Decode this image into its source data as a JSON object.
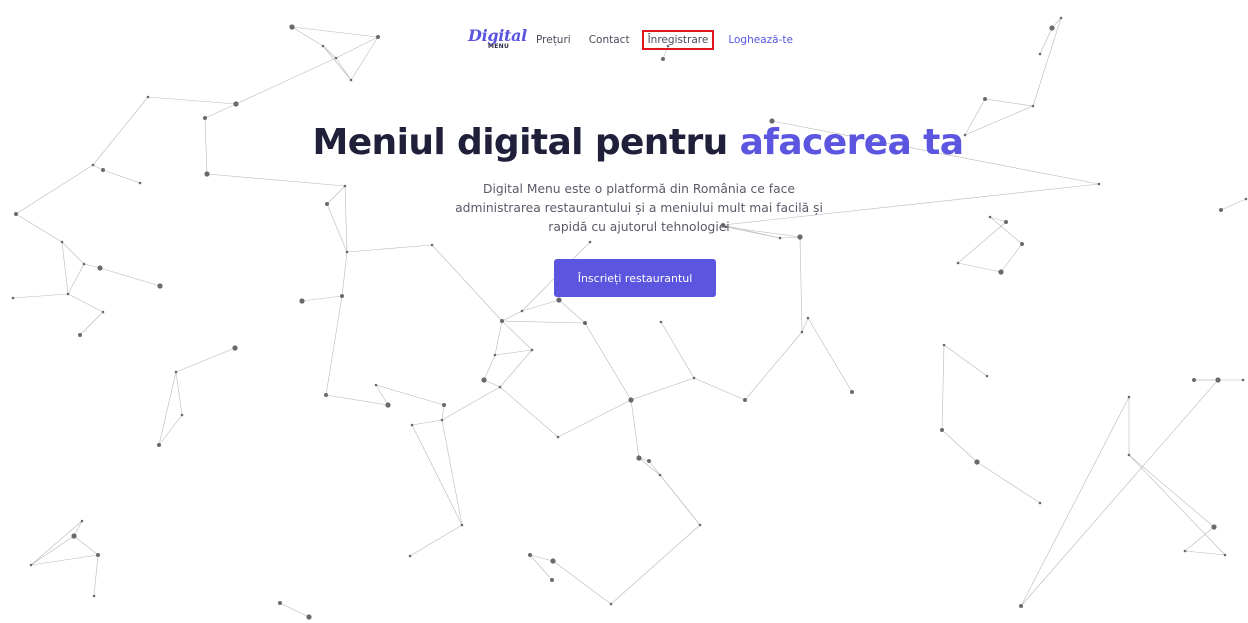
{
  "header": {
    "logo": {
      "word": "Digital",
      "sub": "MENU"
    },
    "nav": [
      {
        "label": "Prețuri"
      },
      {
        "label": "Contact"
      },
      {
        "label": "Înregistrare"
      },
      {
        "label": "Loghează-te"
      }
    ]
  },
  "hero": {
    "title_main": "Meniul digital pentru",
    "title_accent": "afacerea ta",
    "description": "Digital Menu este o platformă din România ce face administrarea restaurantului și a meniului mult mai facilă și rapidă cu ajutorul tehnologiei",
    "cta_label": "Înscrieți restaurantul"
  },
  "colors": {
    "accent": "#5b55e0",
    "title": "#20203a",
    "highlight_border": "#e0161b",
    "network_node": "#6a6a6a",
    "network_line": "#b9b9b9"
  }
}
